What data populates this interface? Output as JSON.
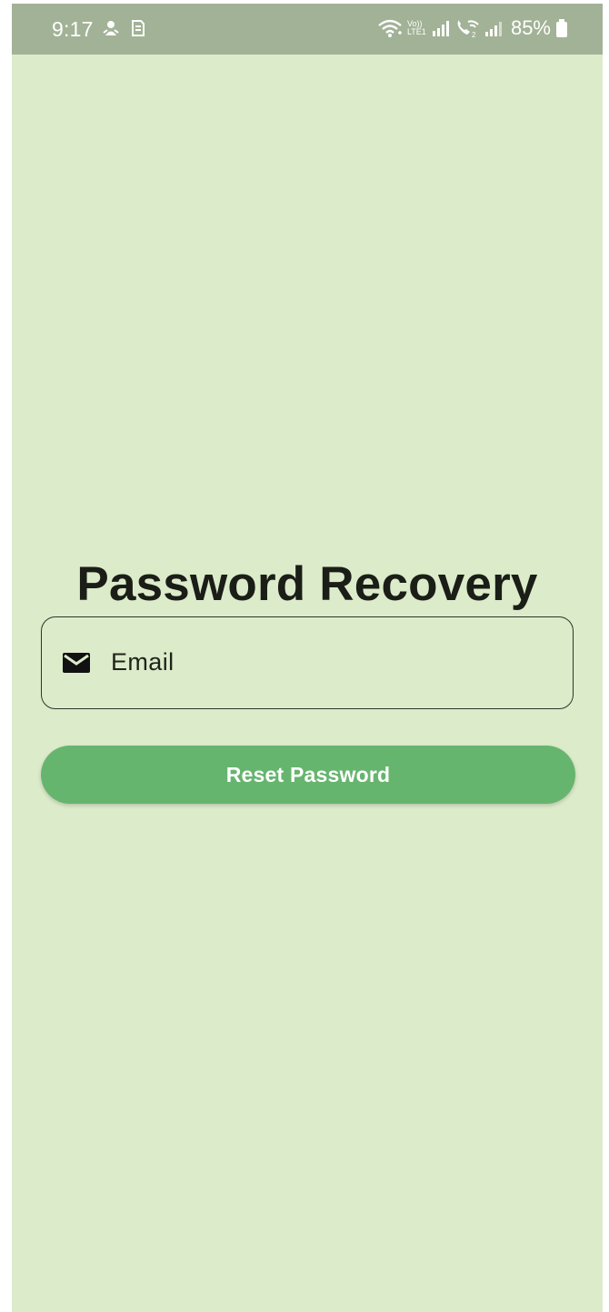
{
  "status_bar": {
    "time": "9:17",
    "lte_label_top": "Vo))",
    "lte_label_bottom": "LTE1",
    "battery": "85%",
    "icons": [
      "notification-icon",
      "sim-icon",
      "wifi-icon",
      "volte-lte-icon",
      "signal-icon",
      "wifi-calling-icon",
      "signal-icon",
      "battery-icon"
    ]
  },
  "page": {
    "title": "Password Recovery"
  },
  "email": {
    "placeholder": "Email",
    "icon": "mail-icon"
  },
  "actions": {
    "reset_label": "Reset Password"
  },
  "colors": {
    "background": "#dcebca",
    "status_bar": "#a2b296",
    "button": "#66b56e",
    "text": "#1b1d17"
  }
}
